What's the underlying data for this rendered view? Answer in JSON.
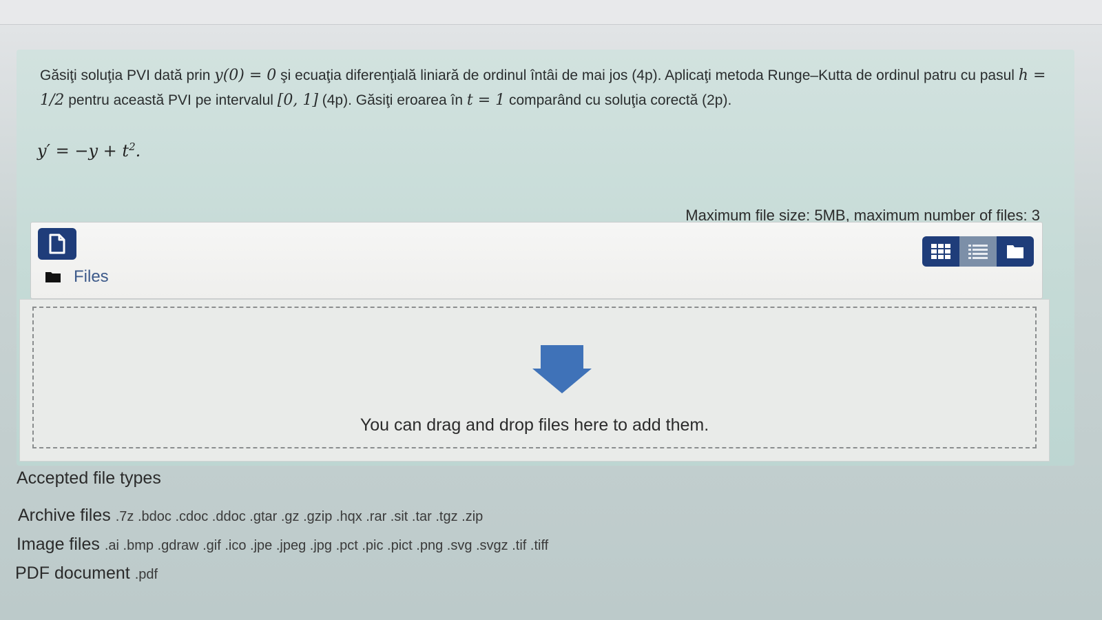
{
  "question": {
    "line1_a": "Găsiţi soluţia PVI dată prin ",
    "ic": "y(0) = 0",
    "line1_b": " şi ecuaţia diferenţială liniară de ordinul întâi de mai jos (4p). Aplicaţi metoda Runge–Kutta de ordinul patru cu pasul ",
    "step": "h = 1/2",
    "line1_c": " pentru această PVI pe intervalul ",
    "interval": "[0, 1]",
    "line1_d": " (4p). Găsiţi eroarea în ",
    "tpoint": "t = 1",
    "line1_e": " comparând cu soluţia corectă (2p).",
    "equation": "y′ = −y + t².",
    "equation_lhs": "y′ = −y + t",
    "equation_exp": "2",
    "equation_end": "."
  },
  "filemanager": {
    "max_info": "Maximum file size: 5MB, maximum number of files: 3",
    "breadcrumb": "Files",
    "drop_text": "You can drag and drop files here to add them."
  },
  "accepted": {
    "title": "Accepted file types",
    "types": [
      {
        "label": "Archive files",
        "exts": ".7z .bdoc .cdoc .ddoc .gtar .gz .gzip .hqx .rar .sit .tar .tgz .zip"
      },
      {
        "label": "Image files",
        "exts": ".ai .bmp .gdraw .gif .ico .jpe .jpeg .jpg .pct .pic .pict .png .svg .svgz .tif .tiff"
      },
      {
        "label": "PDF document",
        "exts": ".pdf"
      }
    ]
  },
  "icons": {
    "add": "add-file-icon",
    "folder": "folder-icon",
    "grid": "grid-view-icon",
    "list": "list-view-icon",
    "tree": "folder-view-icon",
    "drop": "drop-arrow-icon"
  },
  "colors": {
    "primary": "#1f3d7a",
    "drop_arrow": "#3f72b8"
  }
}
